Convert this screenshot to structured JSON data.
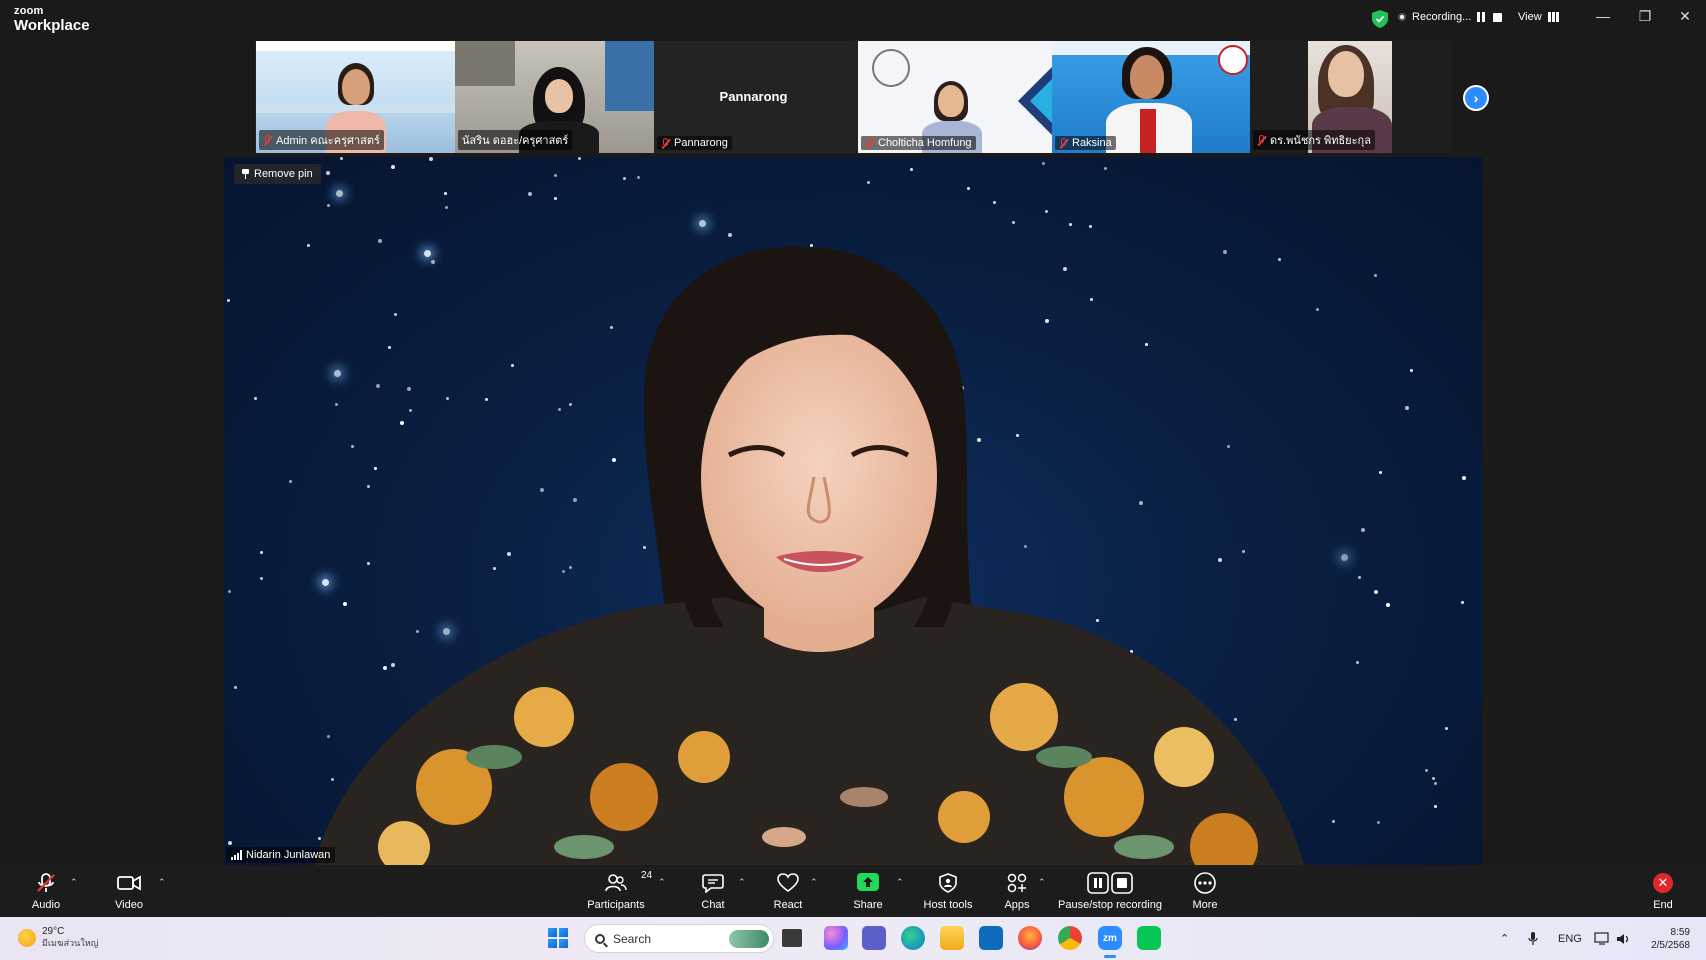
{
  "titlebar": {
    "brand_small": "zoom",
    "brand_large": "Workplace",
    "recording_label": "Recording...",
    "view_label": "View"
  },
  "participants_strip": [
    {
      "name": "Admin คณะครุศาสตร์",
      "muted": true
    },
    {
      "name": "นัสริน ดอฮะ/ครุศาสตร์",
      "muted": false
    },
    {
      "name": "Pannarong",
      "muted": true,
      "display_name_center": "Pannarong"
    },
    {
      "name": "Cholticha Homfung",
      "muted": true
    },
    {
      "name": "Raksina",
      "muted": true
    },
    {
      "name": "ดร.พนัชกร พิทธิยะกุล",
      "muted": true
    }
  ],
  "main_video": {
    "remove_pin_label": "Remove pin",
    "speaker_name": "Nidarin Junlawan"
  },
  "toolbar": {
    "audio_label": "Audio",
    "video_label": "Video",
    "participants_label": "Participants",
    "participants_count": "24",
    "chat_label": "Chat",
    "react_label": "React",
    "share_label": "Share",
    "host_tools_label": "Host tools",
    "apps_label": "Apps",
    "recording_label": "Pause/stop recording",
    "more_label": "More",
    "end_label": "End"
  },
  "taskbar": {
    "weather_temp": "29°C",
    "weather_desc": "มีเมฆส่วนใหญ่",
    "search_placeholder": "Search",
    "language": "ENG",
    "time": "8:59",
    "date": "2/5/2568"
  },
  "colors": {
    "accent_blue": "#2d8cff",
    "share_green": "#23d959",
    "end_red": "#e02828",
    "muted_red": "#e23b3b"
  }
}
